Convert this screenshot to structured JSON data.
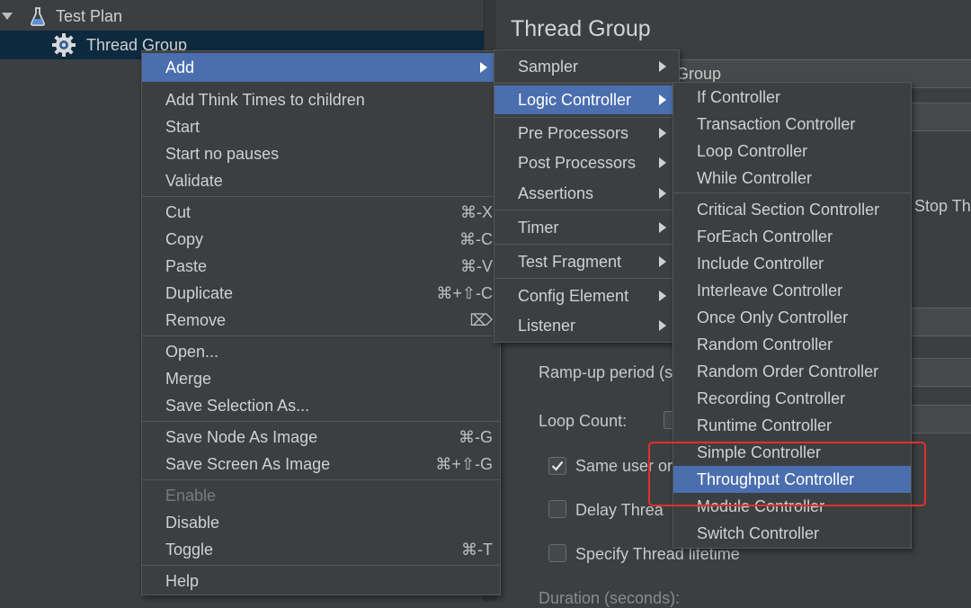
{
  "tree": {
    "items": [
      {
        "label": "Test Plan",
        "icon": "flask-icon"
      },
      {
        "label": "Thread Group",
        "icon": "gear-icon"
      }
    ]
  },
  "panel": {
    "title": "Thread Group",
    "name_partial": "Group",
    "action_partial": "Stop Th",
    "rampup_label": "Ramp-up period (s",
    "loop_label": "Loop Count:",
    "same_user_label": "Same user or",
    "same_user_checked": true,
    "delay_label": "Delay Threa",
    "lifetime_label": "Specify Thread lifetime",
    "duration_label": "Duration (seconds):"
  },
  "context_menu": {
    "items": [
      {
        "label": "Add",
        "submenu": true
      },
      {
        "label": "Add Think Times to children"
      },
      {
        "label": "Start"
      },
      {
        "label": "Start no pauses"
      },
      {
        "label": "Validate"
      },
      {
        "label": "Cut",
        "shortcut": "⌘-X"
      },
      {
        "label": "Copy",
        "shortcut": "⌘-C"
      },
      {
        "label": "Paste",
        "shortcut": "⌘-V"
      },
      {
        "label": "Duplicate",
        "shortcut": "⌘+⇧-C"
      },
      {
        "label": "Remove",
        "shortcut": "⌦"
      },
      {
        "label": "Open..."
      },
      {
        "label": "Merge"
      },
      {
        "label": "Save Selection As..."
      },
      {
        "label": "Save Node As Image",
        "shortcut": "⌘-G"
      },
      {
        "label": "Save Screen As Image",
        "shortcut": "⌘+⇧-G"
      },
      {
        "label": "Enable",
        "disabled": true
      },
      {
        "label": "Disable"
      },
      {
        "label": "Toggle",
        "shortcut": "⌘-T"
      },
      {
        "label": "Help"
      }
    ]
  },
  "add_menu": {
    "items": [
      {
        "label": "Sampler"
      },
      {
        "label": "Logic Controller"
      },
      {
        "label": "Pre Processors"
      },
      {
        "label": "Post Processors"
      },
      {
        "label": "Assertions"
      },
      {
        "label": "Timer"
      },
      {
        "label": "Test Fragment"
      },
      {
        "label": "Config Element"
      },
      {
        "label": "Listener"
      }
    ]
  },
  "logic_menu": {
    "items": [
      {
        "label": "If Controller"
      },
      {
        "label": "Transaction Controller"
      },
      {
        "label": "Loop Controller"
      },
      {
        "label": "While Controller"
      },
      {
        "label": "Critical Section Controller"
      },
      {
        "label": "ForEach Controller"
      },
      {
        "label": "Include Controller"
      },
      {
        "label": "Interleave Controller"
      },
      {
        "label": "Once Only Controller"
      },
      {
        "label": "Random Controller"
      },
      {
        "label": "Random Order Controller"
      },
      {
        "label": "Recording Controller"
      },
      {
        "label": "Runtime Controller"
      },
      {
        "label": "Simple Controller"
      },
      {
        "label": "Throughput Controller"
      },
      {
        "label": "Module Controller"
      },
      {
        "label": "Switch Controller"
      }
    ]
  },
  "colors": {
    "background": "#3c3f41",
    "selection": "#4b6eaf",
    "annotation": "#e0302a"
  }
}
